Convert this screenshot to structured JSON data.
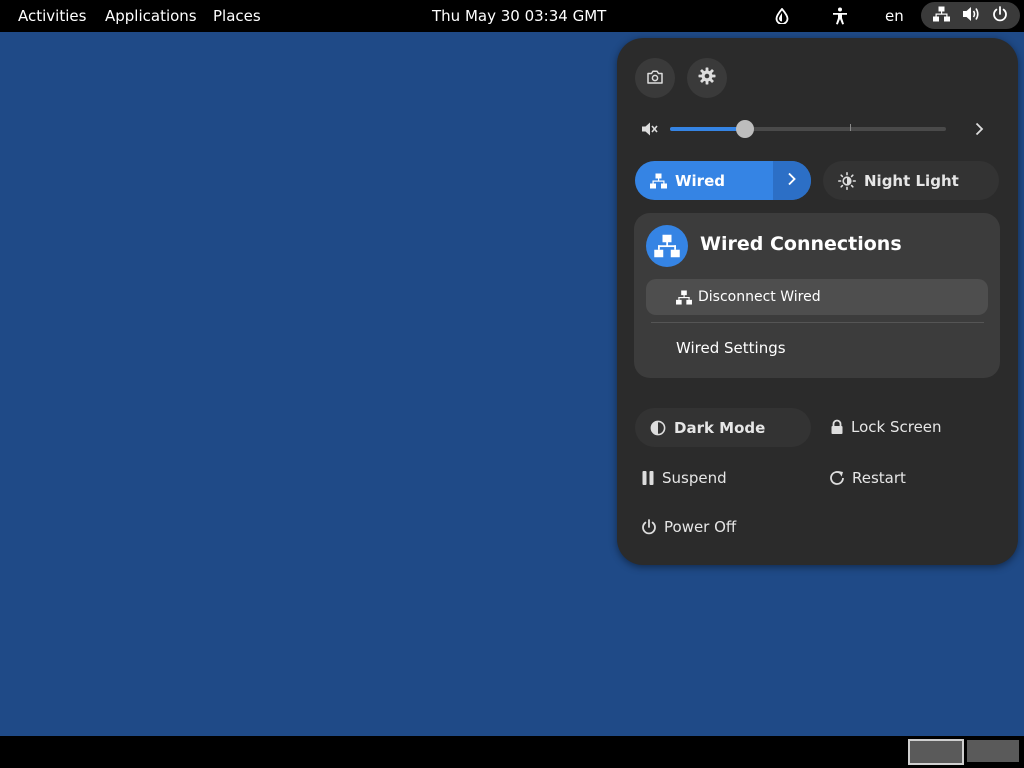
{
  "topbar": {
    "activities": "Activities",
    "applications": "Applications",
    "places": "Places",
    "clock": "Thu May 30  03:34 GMT",
    "language": "en",
    "icons": [
      "drop-icon",
      "accessibility-icon",
      "network-icon",
      "volume-icon",
      "power-icon"
    ]
  },
  "quick_settings": {
    "volume_level": 0.27,
    "wired": {
      "label": "Wired",
      "active": true
    },
    "night_light": {
      "label": "Night Light",
      "active": false
    },
    "wired_menu": {
      "title": "Wired Connections",
      "disconnect": "Disconnect Wired",
      "settings": "Wired Settings"
    },
    "dark_mode": {
      "label": "Dark Mode",
      "active": false
    },
    "lock_screen": "Lock Screen",
    "suspend": "Suspend",
    "restart": "Restart",
    "power_off": "Power Off"
  },
  "workspaces": {
    "count": 2,
    "active": 1
  },
  "colors": {
    "desktop": "#1f4a87",
    "accent": "#3584e4",
    "panel": "#2b2b2b"
  }
}
